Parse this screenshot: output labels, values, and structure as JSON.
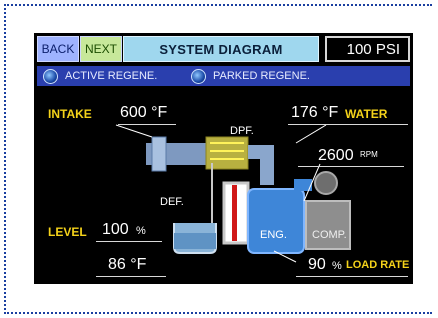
{
  "toolbar": {
    "back_label": "BACK",
    "next_label": "NEXT"
  },
  "header": {
    "title": "SYSTEM DIAGRAM",
    "pressure": "100 PSI"
  },
  "status": {
    "active_label": "ACTIVE REGENE.",
    "parked_label": "PARKED REGENE."
  },
  "readings": {
    "intake_label": "INTAKE",
    "intake_value": "600 °F",
    "water_value": "176 °F",
    "water_label": "WATER",
    "rpm_value": "2600",
    "rpm_unit": "RPM",
    "dpf_label": "DPF.",
    "def_label": "DEF.",
    "eng_label": "ENG.",
    "comp_label": "COMP.",
    "level_label": "LEVEL",
    "level_value": "100",
    "level_unit": "%",
    "def_temp_value": "86 °F",
    "load_value": "90",
    "load_unit": "%",
    "load_label": "LOAD RATE"
  },
  "colors": {
    "accent_yellow": "#f4d21a",
    "status_bar": "#2a3fae",
    "title_bg": "#9fd7ee"
  }
}
